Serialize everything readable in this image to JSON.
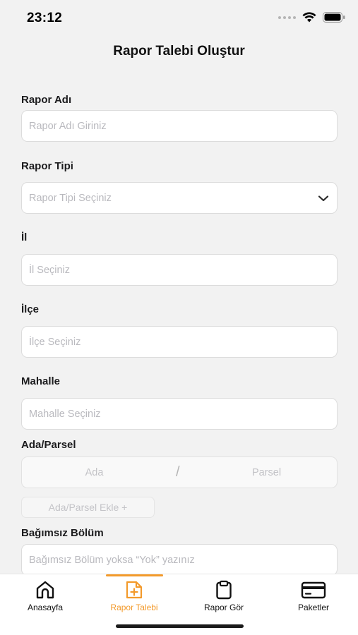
{
  "status_bar": {
    "time": "23:12"
  },
  "header": {
    "title": "Rapor Talebi Oluştur"
  },
  "form": {
    "rapor_adi": {
      "label": "Rapor Adı",
      "placeholder": "Rapor Adı Giriniz"
    },
    "rapor_tipi": {
      "label": "Rapor Tipi",
      "placeholder": "Rapor Tipi Seçiniz"
    },
    "il": {
      "label": "İl",
      "placeholder": "İl Seçiniz"
    },
    "ilce": {
      "label": "İlçe",
      "placeholder": "İlçe Seçiniz"
    },
    "mahalle": {
      "label": "Mahalle",
      "placeholder": "Mahalle Seçiniz"
    },
    "ada_parsel": {
      "label": "Ada/Parsel",
      "ada_placeholder": "Ada",
      "separator": "/",
      "parsel_placeholder": "Parsel",
      "add_button": "Ada/Parsel Ekle +"
    },
    "bagimsiz_bolum": {
      "label": "Bağımsız Bölüm",
      "placeholder": "Bağımsız Bölüm yoksa “Yok” yazınız"
    }
  },
  "tab_bar": {
    "items": [
      {
        "label": "Anasayfa",
        "icon": "home-icon",
        "active": false
      },
      {
        "label": "Rapor Talebi",
        "icon": "document-add-icon",
        "active": true
      },
      {
        "label": "Rapor Gör",
        "icon": "clipboard-icon",
        "active": false
      },
      {
        "label": "Paketler",
        "icon": "credit-card-icon",
        "active": false
      }
    ]
  },
  "colors": {
    "accent": "#f39a2b",
    "background": "#f2f2f2",
    "input_background": "#ffffff",
    "placeholder": "#b9b9be"
  }
}
